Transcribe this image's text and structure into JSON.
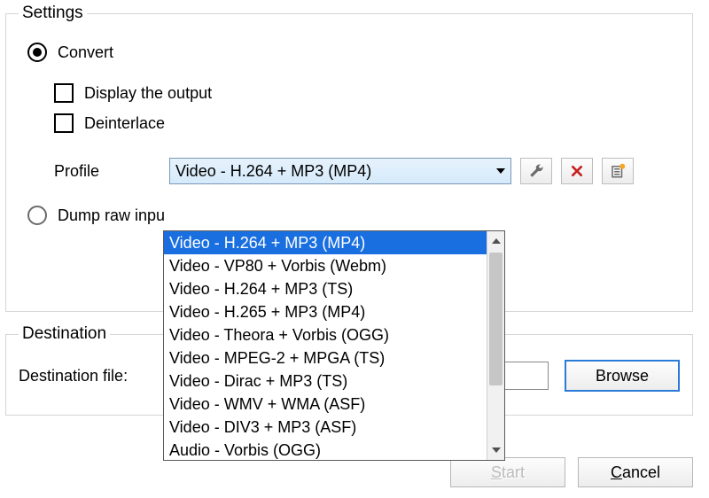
{
  "settings": {
    "legend": "Settings",
    "convert_label": "Convert",
    "display_label": "Display the output",
    "deinterlace_label": "Deinterlace",
    "profile_label": "Profile",
    "dump_label": "Dump raw input"
  },
  "profile": {
    "selected": "Video - H.264 + MP3 (MP4)",
    "options": [
      "Video - H.264 + MP3 (MP4)",
      "Video - VP80 + Vorbis (Webm)",
      "Video - H.264 + MP3 (TS)",
      "Video - H.265 + MP3 (MP4)",
      "Video - Theora + Vorbis (OGG)",
      "Video - MPEG-2 + MPGA (TS)",
      "Video - Dirac + MP3 (TS)",
      "Video - WMV + WMA (ASF)",
      "Video - DIV3 + MP3 (ASF)",
      "Audio - Vorbis (OGG)"
    ]
  },
  "icons": {
    "wrench": "settings-icon",
    "delete": "delete-icon",
    "new": "new-profile-icon"
  },
  "destination": {
    "legend": "Destination",
    "file_label": "Destination file:",
    "file_value": "",
    "browse_label": "Browse"
  },
  "buttons": {
    "start_prefix": "S",
    "start_suffix": "tart",
    "cancel_prefix": "C",
    "cancel_suffix": "ancel"
  }
}
